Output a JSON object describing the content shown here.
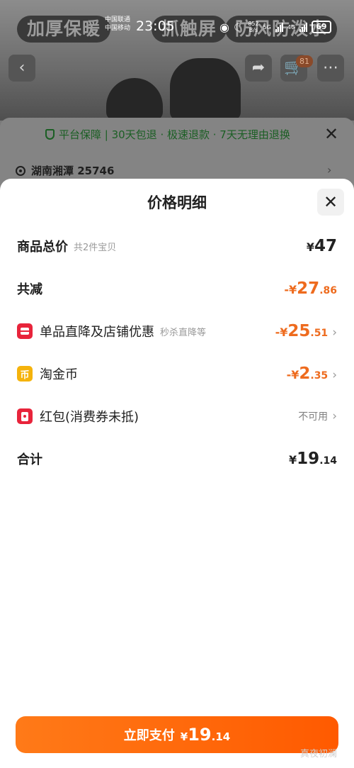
{
  "background": {
    "banners": [
      "加厚保暖",
      "抓触屏",
      "防风防泼水"
    ],
    "cart_count": "81"
  },
  "status_bar": {
    "carrier_1": "中国联通",
    "carrier_2": "中国移动",
    "time": "23:05",
    "net_speed_value": "852",
    "net_speed_unit": "B/s",
    "net_5g": "5G",
    "net_4g": "4G",
    "battery": "69"
  },
  "service": {
    "guarantee_text": "平台保障 | 30天包退 · 极速退款 · 7天无理由退换",
    "location": "湖南湘潭 25746"
  },
  "sheet": {
    "title": "价格明细",
    "total": {
      "label": "商品总价",
      "sub": "共2件宝贝",
      "currency": "¥",
      "int": "47",
      "dec": ""
    },
    "discount": {
      "label": "共减",
      "prefix": "-¥",
      "int": "27",
      "dec": ".86"
    },
    "item_discount": {
      "label": "单品直降及店铺优惠",
      "sub": "秒杀直降等",
      "prefix": "-¥",
      "int": "25",
      "dec": ".51"
    },
    "coins": {
      "label": "淘金币",
      "badge": "币",
      "prefix": "-¥",
      "int": "2",
      "dec": ".35"
    },
    "red_packet": {
      "label": "红包(消费券未抵)",
      "status": "不可用"
    },
    "sum": {
      "label": "合计",
      "currency": "¥",
      "int": "19",
      "dec": ".14"
    }
  },
  "pay_button": {
    "label": "立即支付",
    "currency": "¥",
    "int": "19",
    "dec": ".14"
  },
  "watermark": "真夜初澜",
  "colors": {
    "accent": "#ee6b1e",
    "pay_button": "#ff6a0a",
    "badge_red": "#e8243b",
    "coin_gold": "#f5b30c",
    "guarantee_green": "#1b5f24"
  }
}
